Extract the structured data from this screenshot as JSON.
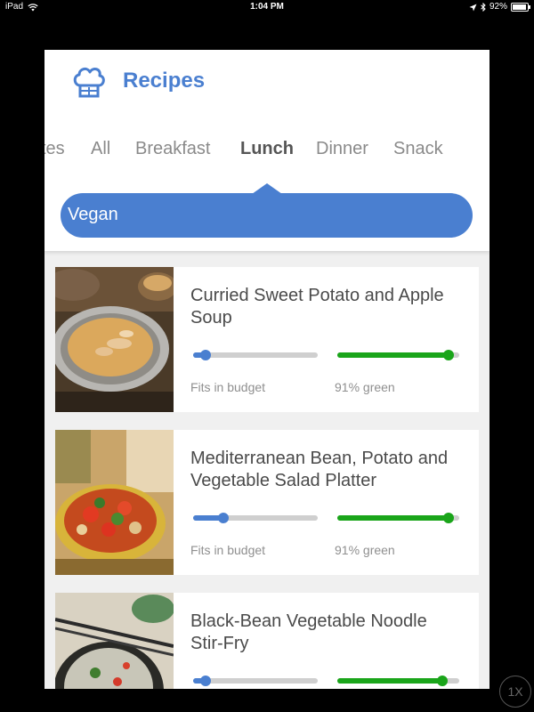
{
  "status_bar": {
    "device": "iPad",
    "time": "1:04 PM",
    "battery": "92%",
    "battery_level": 0.92
  },
  "header": {
    "title": "Recipes"
  },
  "tabs": [
    {
      "label": "tes"
    },
    {
      "label": "All"
    },
    {
      "label": "Breakfast"
    },
    {
      "label": "Lunch",
      "active": true
    },
    {
      "label": "Dinner"
    },
    {
      "label": "Snack"
    }
  ],
  "filter": {
    "label": "Vegan"
  },
  "recipes": [
    {
      "title": "Curried Sweet Potato and Apple Soup",
      "budget_label": "Fits in budget",
      "budget_level": 0.1,
      "green_label": "91% green",
      "green_level": 0.91,
      "image": "soup-photo"
    },
    {
      "title": "Mediterranean Bean, Potato and Vegetable Salad Platter",
      "budget_label": "Fits in budget",
      "budget_level": 0.24,
      "green_label": "91% green",
      "green_level": 0.91,
      "image": "salad-platter-photo"
    },
    {
      "title": "Black-Bean Vegetable Noodle Stir-Fry",
      "budget_label": "",
      "budget_level": 0.1,
      "green_label": "",
      "green_level": 0.86,
      "image": "noodle-stir-fry-photo"
    }
  ],
  "colors": {
    "accent": "#4a7fd0",
    "green": "#1aa51a",
    "track": "#cfcfcf"
  },
  "overlay": {
    "zoom": "1X"
  }
}
